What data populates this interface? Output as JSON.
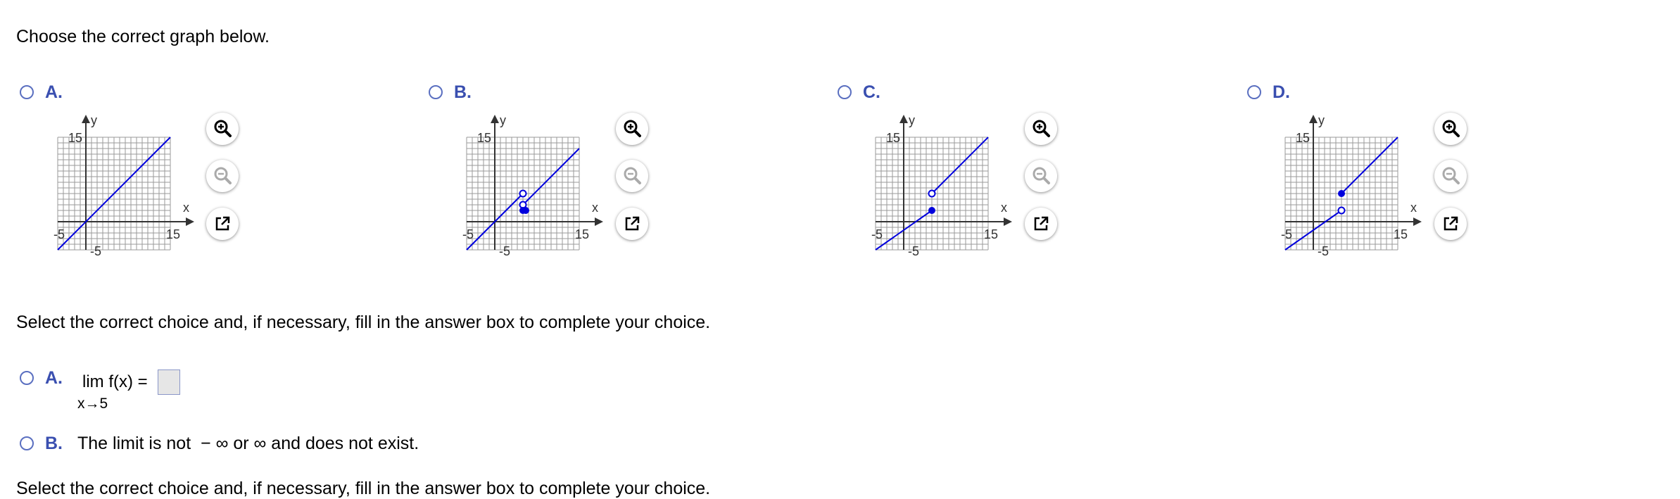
{
  "question": {
    "prompt": "Choose the correct graph below.",
    "options": [
      {
        "letter": "A.",
        "axis_x": "x",
        "axis_y": "y",
        "tick_x_min": "-5",
        "tick_x_max": "15",
        "tick_y_min": "-5",
        "tick_y_max": "15"
      },
      {
        "letter": "B.",
        "axis_x": "x",
        "axis_y": "y",
        "tick_x_min": "-5",
        "tick_x_max": "15",
        "tick_y_min": "-5",
        "tick_y_max": "15"
      },
      {
        "letter": "C.",
        "axis_x": "x",
        "axis_y": "y",
        "tick_x_min": "-5",
        "tick_x_max": "15",
        "tick_y_min": "-5",
        "tick_y_max": "15"
      },
      {
        "letter": "D.",
        "axis_x": "x",
        "axis_y": "y",
        "tick_x_min": "-5",
        "tick_x_max": "15",
        "tick_y_min": "-5",
        "tick_y_max": "15"
      }
    ],
    "tools": [
      "zoom-in-icon",
      "zoom-out-icon",
      "open-external-icon"
    ]
  },
  "limit_question": {
    "prompt": "Select the correct choice and, if necessary, fill in the answer box to complete your choice.",
    "choice_a": {
      "letter": "A.",
      "expr": "lim f(x) =",
      "sub": "x→5",
      "answer": ""
    },
    "choice_b": {
      "letter": "B.",
      "text": "The limit is not  − ∞ or ∞ and does not exist."
    }
  },
  "next_prompt": "Select the correct choice and, if necessary, fill in the answer box to complete your choice.",
  "colors": {
    "accent": "#3a4fb0",
    "curve": "#0000dd",
    "grid": "#9a9a9a"
  }
}
